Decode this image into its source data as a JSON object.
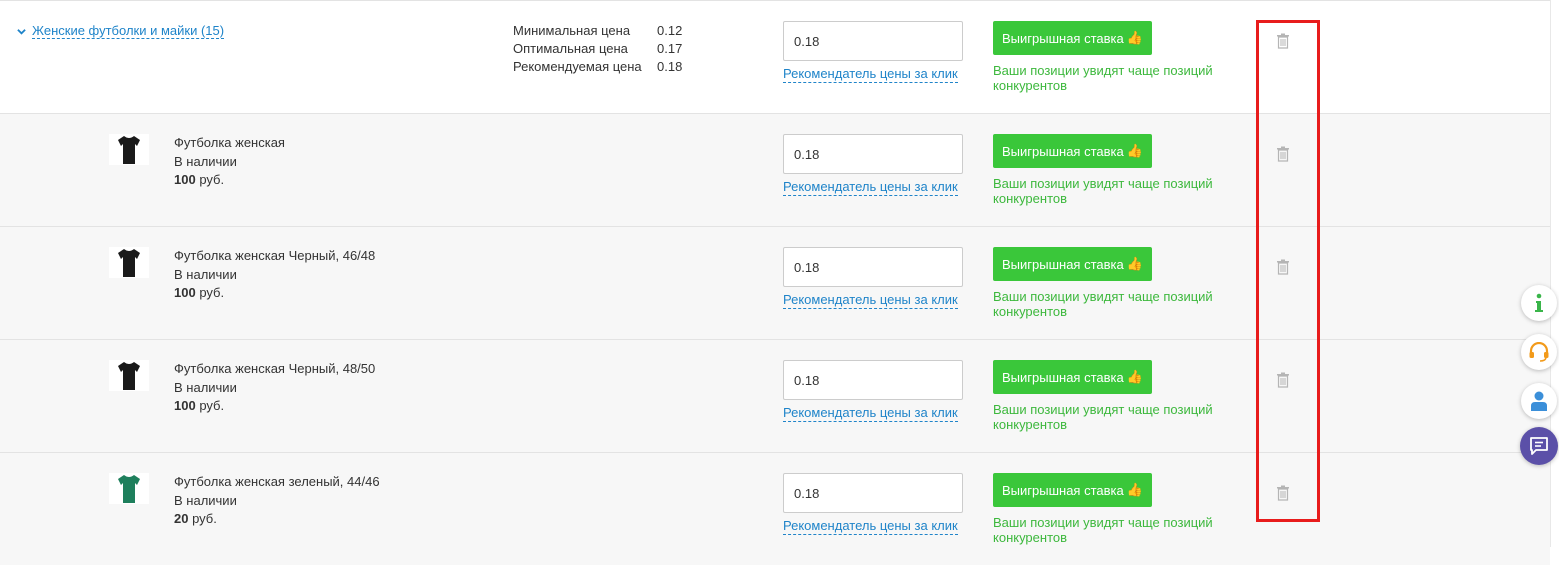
{
  "category": {
    "toggle_label": "Женские футболки и майки (15)",
    "min_price_label": "Минимальная цена",
    "min_price": "0.12",
    "opt_price_label": "Оптимальная цена",
    "opt_price": "0.17",
    "rec_price_label": "Рекомендуемая цена",
    "rec_price": "0.18",
    "bid_value": "0.18",
    "recommender_link": "Рекомендатель цены за клик",
    "win_button": "Выигрышная ставка",
    "win_note": "Ваши позиции увидят чаще позиций конкурентов"
  },
  "products": [
    {
      "name": "Футболка женская",
      "stock": "В наличии",
      "price_value": "100",
      "price_unit": " руб.",
      "shirt_color": "#1a1a1a",
      "bid_value": "0.18",
      "recommender_link": "Рекомендатель цены за клик",
      "win_button": "Выигрышная ставка",
      "win_note": "Ваши позиции увидят чаще позиций конкурентов"
    },
    {
      "name": "Футболка женская Черный, 46/48",
      "stock": "В наличии",
      "price_value": "100",
      "price_unit": " руб.",
      "shirt_color": "#1a1a1a",
      "bid_value": "0.18",
      "recommender_link": "Рекомендатель цены за клик",
      "win_button": "Выигрышная ставка",
      "win_note": "Ваши позиции увидят чаще позиций конкурентов"
    },
    {
      "name": "Футболка женская Черный, 48/50",
      "stock": "В наличии",
      "price_value": "100",
      "price_unit": " руб.",
      "shirt_color": "#1a1a1a",
      "bid_value": "0.18",
      "recommender_link": "Рекомендатель цены за клик",
      "win_button": "Выигрышная ставка",
      "win_note": "Ваши позиции увидят чаще позиций конкурентов"
    },
    {
      "name": "Футболка женская зеленый, 44/46",
      "stock": "В наличии",
      "price_value": "20",
      "price_unit": " руб.",
      "shirt_color": "#1e7f5c",
      "bid_value": "0.18",
      "recommender_link": "Рекомендатель цены за клик",
      "win_button": "Выигрышная ставка",
      "win_note": "Ваши позиции увидят чаще позиций конкурентов"
    }
  ],
  "icons": {
    "win_button_icon": "thumbs-up-icon",
    "delete_icon": "trash-icon",
    "side_buttons": [
      "info-icon",
      "support-headset-icon",
      "profile-icon",
      "chat-icon"
    ]
  },
  "colors": {
    "link_blue": "#1f84c9",
    "win_green": "#3ac73a",
    "note_green": "#3db83d",
    "highlight_red": "#e81c1c",
    "chat_purple": "#5b50a8"
  }
}
